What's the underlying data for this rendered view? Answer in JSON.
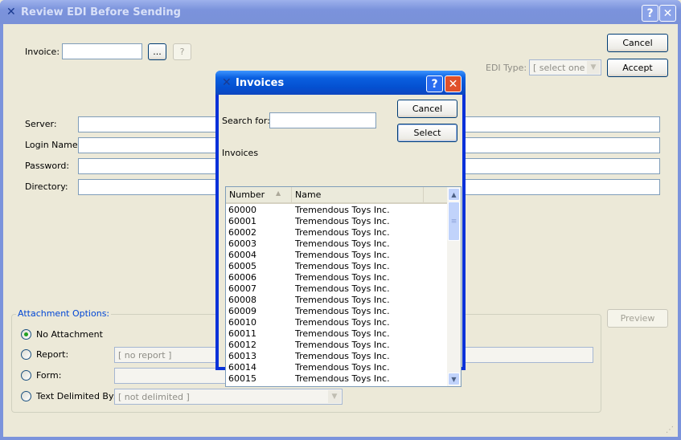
{
  "main": {
    "title": "Review EDI Before Sending",
    "invoice_label": "Invoice:",
    "invoice_value": "",
    "lookup_button": "...",
    "help_button": "?",
    "cancel_button": "Cancel",
    "accept_button": "Accept",
    "edi_type_label": "EDI Type:",
    "edi_type_value": "[ select one ]",
    "fields": [
      {
        "label": "Server:",
        "value": ""
      },
      {
        "label": "Login Name:",
        "value": ""
      },
      {
        "label": "Password:",
        "value": ""
      },
      {
        "label": "Directory:",
        "value": ""
      }
    ],
    "preview_button": "Preview",
    "attachment": {
      "title": "Attachment Options:",
      "options": [
        {
          "label": "No Attachment",
          "selected": true
        },
        {
          "label": "Report:",
          "value": "[ no report ]"
        },
        {
          "label": "Form:",
          "value": ""
        },
        {
          "label": "Text Delimited By:",
          "value": "[ not delimited ]"
        }
      ]
    }
  },
  "dialog": {
    "title": "Invoices",
    "search_label": "Search for:",
    "search_value": "",
    "cancel_button": "Cancel",
    "select_button": "Select",
    "list_label": "Invoices",
    "columns": [
      "Number",
      "Name"
    ],
    "rows": [
      [
        "60000",
        "Tremendous Toys Inc."
      ],
      [
        "60001",
        "Tremendous Toys Inc."
      ],
      [
        "60002",
        "Tremendous Toys Inc."
      ],
      [
        "60003",
        "Tremendous Toys Inc."
      ],
      [
        "60004",
        "Tremendous Toys Inc."
      ],
      [
        "60005",
        "Tremendous Toys Inc."
      ],
      [
        "60006",
        "Tremendous Toys Inc."
      ],
      [
        "60007",
        "Tremendous Toys Inc."
      ],
      [
        "60008",
        "Tremendous Toys Inc."
      ],
      [
        "60009",
        "Tremendous Toys Inc."
      ],
      [
        "60010",
        "Tremendous Toys Inc."
      ],
      [
        "60011",
        "Tremendous Toys Inc."
      ],
      [
        "60012",
        "Tremendous Toys Inc."
      ],
      [
        "60013",
        "Tremendous Toys Inc."
      ],
      [
        "60014",
        "Tremendous Toys Inc."
      ],
      [
        "60015",
        "Tremendous Toys Inc."
      ]
    ]
  }
}
